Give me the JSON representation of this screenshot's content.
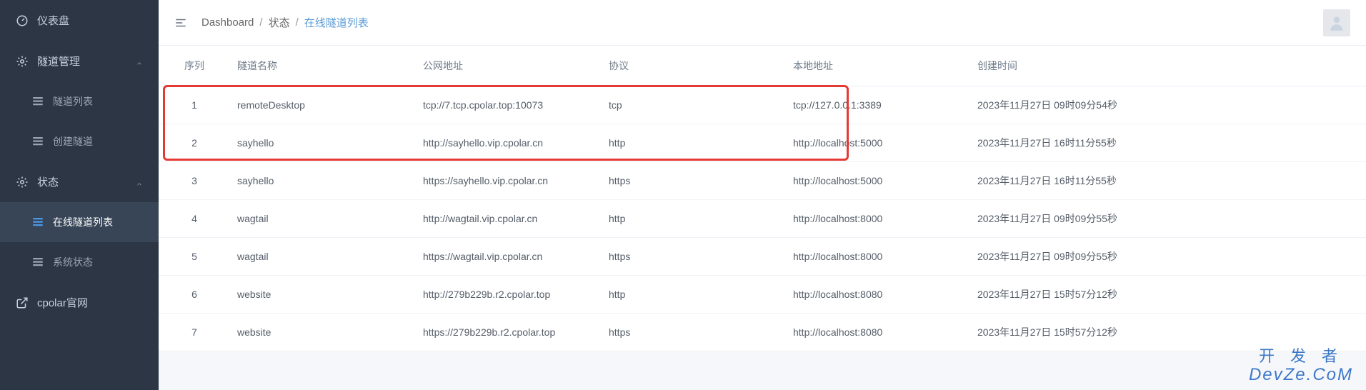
{
  "sidebar": {
    "items": [
      {
        "label": "仪表盘",
        "icon": "gauge"
      },
      {
        "label": "隧道管理",
        "icon": "gear",
        "expandable": true
      },
      {
        "label": "隧道列表",
        "icon": "grid",
        "level": 2
      },
      {
        "label": "创建隧道",
        "icon": "grid",
        "level": 2
      },
      {
        "label": "状态",
        "icon": "gear",
        "expandable": true
      },
      {
        "label": "在线隧道列表",
        "icon": "grid-blue",
        "level": 2,
        "active": true
      },
      {
        "label": "系统状态",
        "icon": "grid",
        "level": 2
      },
      {
        "label": "cpolar官网",
        "icon": "external"
      }
    ]
  },
  "breadcrumb": {
    "root": "Dashboard",
    "mid": "状态",
    "current": "在线隧道列表"
  },
  "table": {
    "columns": [
      "序列",
      "隧道名称",
      "公网地址",
      "协议",
      "本地地址",
      "创建时间"
    ],
    "rows": [
      {
        "seq": "1",
        "name": "remoteDesktop",
        "public": "tcp://7.tcp.cpolar.top:10073",
        "proto": "tcp",
        "local": "tcp://127.0.0.1:3389",
        "created": "2023年11月27日 09时09分54秒"
      },
      {
        "seq": "2",
        "name": "sayhello",
        "public": "http://sayhello.vip.cpolar.cn",
        "proto": "http",
        "local": "http://localhost:5000",
        "created": "2023年11月27日 16时11分55秒"
      },
      {
        "seq": "3",
        "name": "sayhello",
        "public": "https://sayhello.vip.cpolar.cn",
        "proto": "https",
        "local": "http://localhost:5000",
        "created": "2023年11月27日 16时11分55秒"
      },
      {
        "seq": "4",
        "name": "wagtail",
        "public": "http://wagtail.vip.cpolar.cn",
        "proto": "http",
        "local": "http://localhost:8000",
        "created": "2023年11月27日 09时09分55秒"
      },
      {
        "seq": "5",
        "name": "wagtail",
        "public": "https://wagtail.vip.cpolar.cn",
        "proto": "https",
        "local": "http://localhost:8000",
        "created": "2023年11月27日 09时09分55秒"
      },
      {
        "seq": "6",
        "name": "website",
        "public": "http://279b229b.r2.cpolar.top",
        "proto": "http",
        "local": "http://localhost:8080",
        "created": "2023年11月27日 15时57分12秒"
      },
      {
        "seq": "7",
        "name": "website",
        "public": "https://279b229b.r2.cpolar.top",
        "proto": "https",
        "local": "http://localhost:8080",
        "created": "2023年11月27日 15时57分12秒"
      }
    ]
  },
  "watermark": {
    "line1": "开发者",
    "line2": "DevZe.CoM"
  }
}
